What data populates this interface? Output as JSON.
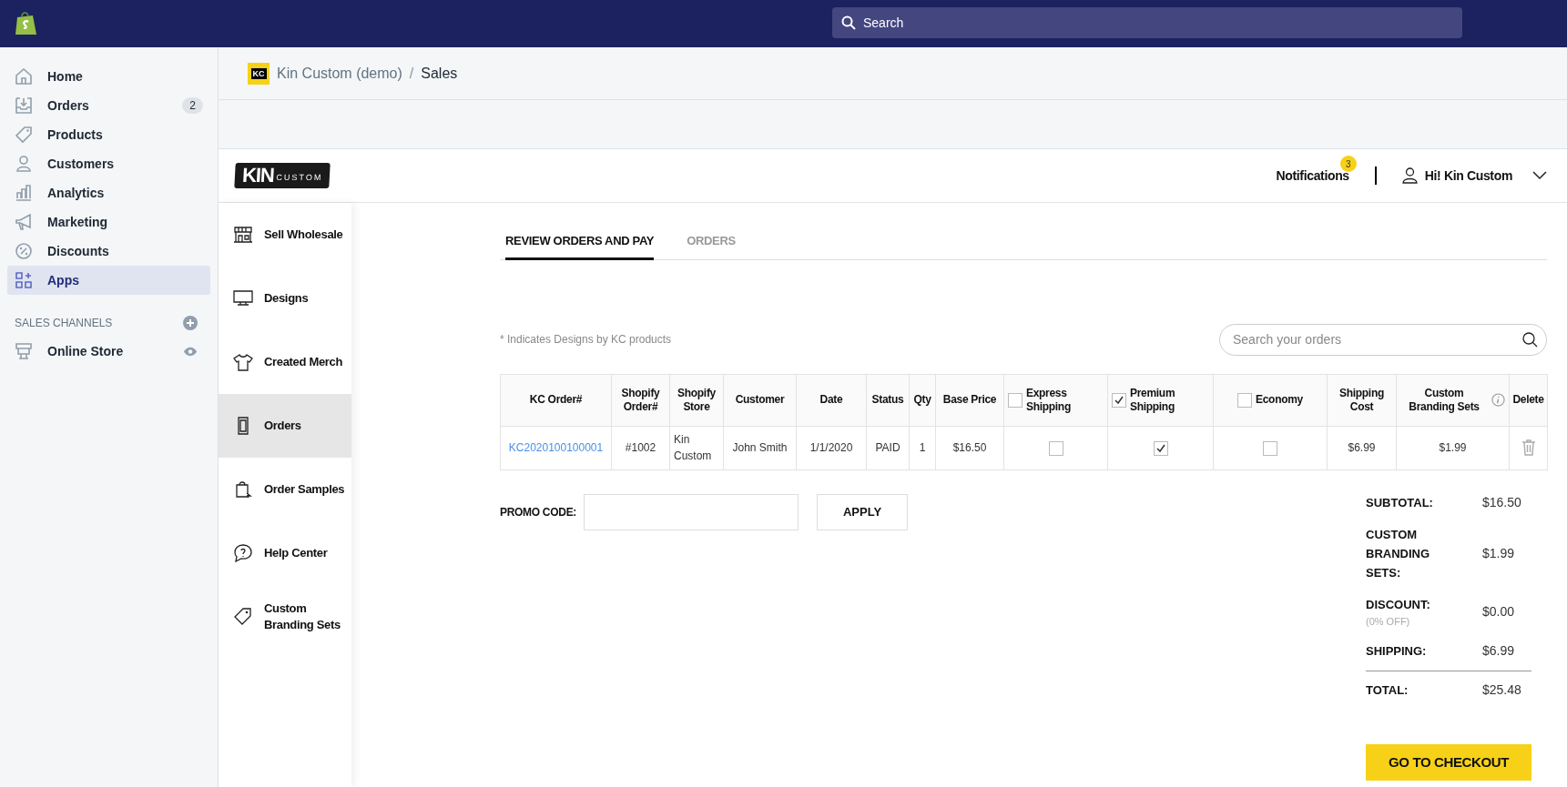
{
  "top_bar": {
    "search_placeholder": "Search"
  },
  "sidebar": {
    "items": [
      {
        "label": "Home",
        "selected": false
      },
      {
        "label": "Orders",
        "badge": "2",
        "selected": false
      },
      {
        "label": "Products",
        "selected": false
      },
      {
        "label": "Customers",
        "selected": false
      },
      {
        "label": "Analytics",
        "selected": false
      },
      {
        "label": "Marketing",
        "selected": false
      },
      {
        "label": "Discounts",
        "selected": false
      },
      {
        "label": "Apps",
        "selected": true
      }
    ],
    "sales_channels": {
      "heading": "SALES CHANNELS",
      "items": [
        {
          "label": "Online Store"
        }
      ]
    }
  },
  "breadcrumb": {
    "store_badge": "KC",
    "store": "Kin Custom (demo)",
    "separator": "/",
    "page": "Sales"
  },
  "app_header": {
    "logo": {
      "big": "KIN",
      "small": "CUSTOM"
    },
    "notifications": {
      "label": "Notifications",
      "count": "3"
    },
    "user": "Hi! Kin Custom"
  },
  "app_nav": {
    "items": [
      {
        "label": "Sell Wholesale",
        "selected": false
      },
      {
        "label": "Designs",
        "selected": false
      },
      {
        "label": "Created Merch",
        "selected": false
      },
      {
        "label": "Orders",
        "selected": true
      },
      {
        "label": "Order Samples",
        "selected": false
      },
      {
        "label": "Help Center",
        "selected": false
      },
      {
        "label": "Custom Branding Sets",
        "selected": false
      }
    ]
  },
  "tabs": [
    {
      "label": "REVIEW ORDERS AND PAY",
      "selected": true
    },
    {
      "label": "ORDERS",
      "selected": false
    }
  ],
  "note": "* Indicates Designs by KC products",
  "search": {
    "placeholder": "Search your orders"
  },
  "table": {
    "columns": [
      {
        "label": "KC Order#",
        "kind": "text"
      },
      {
        "label": "Shopify Order#",
        "kind": "text"
      },
      {
        "label": "Shopify Store",
        "kind": "text"
      },
      {
        "label": "Customer",
        "kind": "text"
      },
      {
        "label": "Date",
        "kind": "text"
      },
      {
        "label": "Status",
        "kind": "text"
      },
      {
        "label": "Qty",
        "kind": "text"
      },
      {
        "label": "Base Price",
        "kind": "text"
      },
      {
        "label": "Express Shipping",
        "kind": "checkbox",
        "checked": false
      },
      {
        "label": "Premium Shipping",
        "kind": "checkbox",
        "checked": true
      },
      {
        "label": "Economy",
        "kind": "checkbox",
        "checked": false
      },
      {
        "label": "Shipping Cost",
        "kind": "text"
      },
      {
        "label": "Custom Branding Sets",
        "kind": "info"
      },
      {
        "label": "Delete",
        "kind": "text"
      }
    ],
    "rows": [
      {
        "cells": [
          {
            "kind": "link",
            "text": "KC2020100100001"
          },
          {
            "kind": "text",
            "text": "#1002"
          },
          {
            "kind": "text",
            "text": "Kin Custom"
          },
          {
            "kind": "text",
            "text": "John Smith"
          },
          {
            "kind": "text",
            "text": "1/1/2020"
          },
          {
            "kind": "text",
            "text": "PAID"
          },
          {
            "kind": "text",
            "text": "1"
          },
          {
            "kind": "text",
            "text": "$16.50"
          },
          {
            "kind": "checkbox",
            "checked": false
          },
          {
            "kind": "checkbox",
            "checked": true
          },
          {
            "kind": "checkbox",
            "checked": false
          },
          {
            "kind": "text",
            "text": "$6.99"
          },
          {
            "kind": "text",
            "text": "$1.99"
          },
          {
            "kind": "delete"
          }
        ]
      }
    ]
  },
  "promo": {
    "label": "PROMO CODE:",
    "button": "APPLY"
  },
  "summary": [
    {
      "kind": "line",
      "label": "SUBTOTAL:",
      "value": "$16.50"
    },
    {
      "kind": "line",
      "label": "CUSTOM BRANDING SETS:",
      "value": "$1.99"
    },
    {
      "kind": "line",
      "label": "DISCOUNT:",
      "note": "(0% OFF)",
      "value": "$0.00"
    },
    {
      "kind": "line",
      "label": "SHIPPING:",
      "value": "$6.99"
    },
    {
      "kind": "total",
      "label": "TOTAL:",
      "value": "$25.48"
    }
  ],
  "checkout_button": "GO TO CHECKOUT"
}
